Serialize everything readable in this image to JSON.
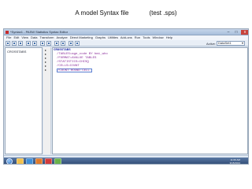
{
  "slide": {
    "title": "A model Syntax file",
    "subtitle": "(test .sps)"
  },
  "window": {
    "title": "*Syntax1 - PASW Statistics Syntax Editor",
    "minimize": "–",
    "maximize": "□",
    "close": "x"
  },
  "menu": [
    "File",
    "Edit",
    "View",
    "Data",
    "Transform",
    "Analyze",
    "Direct Marketing",
    "Graphs",
    "Utilities",
    "Add-ons",
    "Run",
    "Tools",
    "Window",
    "Help"
  ],
  "toolbar": {
    "active_label": "Active:",
    "active_dataset": "DataSet1"
  },
  "nav": {
    "items": [
      "CROSSTABS"
    ]
  },
  "editor": {
    "lines": [
      "CROSSTABS",
      "/TABLES=age_code BY bmi_who",
      "/FORMAT=AVALUE TABLES",
      "/STATISTICS=CHISQ",
      "/CELLS=COUNT",
      "/COUNT ROUND CELL."
    ]
  },
  "status": {
    "processor": "PASW Statistics Processor is ready",
    "position": "In 7 Col 20"
  },
  "taskbar": {
    "time": "11:06 AM",
    "date": "3/15/2013",
    "icon_colors": [
      "#f2c14e",
      "#3f8fd8",
      "#e07a2b",
      "#d33b3b",
      "#6bb24a"
    ]
  }
}
